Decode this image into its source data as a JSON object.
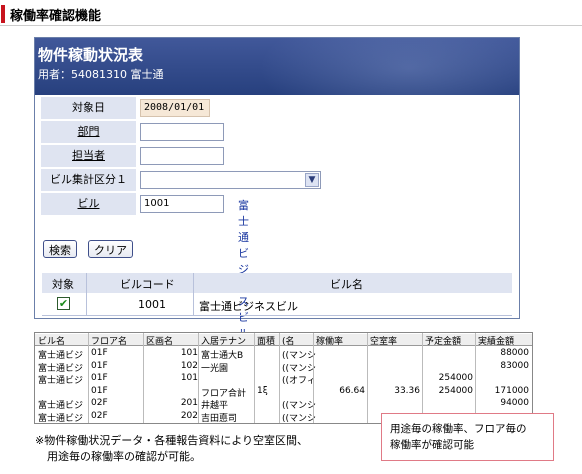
{
  "page": {
    "title": "稼働率確認機能"
  },
  "screen1": {
    "title": "物件稼動状況表",
    "user_line": "用者：54081310 富士通",
    "form": {
      "date_label": "対象日",
      "date_value": "2008/01/01",
      "dept_label": "部門",
      "owner_label": "担当者",
      "category_label": "ビル集計区分１",
      "building_label": "ビル",
      "building_code": "1001",
      "building_name": "富士通ビジネスビル"
    },
    "buttons": {
      "search": "検索",
      "clear": "クリア"
    },
    "result": {
      "headers": [
        "対象",
        "ビルコード",
        "ビル名"
      ],
      "row": {
        "code": "1001",
        "name": "富士通ビジネスビル",
        "checked": "✔"
      }
    }
  },
  "screen2": {
    "headers": [
      "ビル名",
      "フロア名",
      "区画名",
      "入居テナン",
      "面積",
      "(名",
      "稼働率",
      "空室率",
      "予定金額",
      "実績金額"
    ],
    "rows": [
      [
        "富士通ビジ",
        "01F",
        "101",
        "富士通大B",
        "",
        "((マンシ",
        "",
        "",
        "",
        "88000"
      ],
      [
        "富士通ビジ",
        "01F",
        "102",
        "一光園",
        "",
        "((マンシ",
        "",
        "",
        "",
        "83000"
      ],
      [
        "富士通ビジ",
        "01F",
        "101",
        "",
        "",
        "((オフィ",
        "",
        "",
        "254000",
        ""
      ],
      [
        "",
        "01F",
        "",
        "フロア合計",
        "1ξ",
        "",
        "66.64",
        "33.36",
        "254000",
        "171000"
      ],
      [
        "富士通ビジ",
        "02F",
        "201",
        "井越平",
        "",
        "((マンシ",
        "",
        "",
        "",
        "94000"
      ],
      [
        "富士通ビジ",
        "02F",
        "202",
        "吉田悳司",
        "",
        "((マンシ",
        "",
        "",
        "",
        ""
      ]
    ]
  },
  "note": {
    "line1": "※物件稼働状況データ・各種報告資料により空室区間、",
    "line2": "用途毎の稼働率の確認が可能。"
  },
  "callout": {
    "line1": "用途毎の稼働率、フロア毎の",
    "line2": "稼働率が確認可能"
  }
}
